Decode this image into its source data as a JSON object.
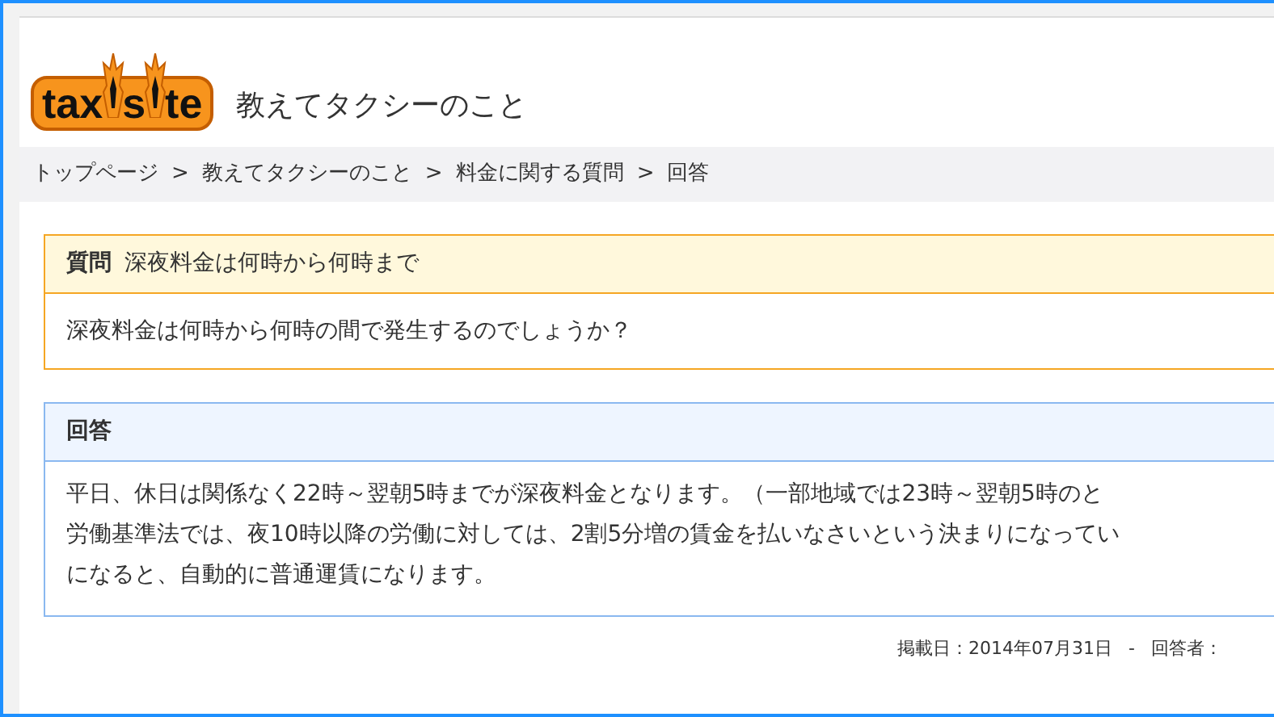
{
  "header": {
    "logo_parts": [
      "tax",
      "s",
      "te"
    ],
    "site_title": "教えてタクシーのこと"
  },
  "breadcrumb": {
    "items": [
      "トップページ",
      "教えてタクシーのこと",
      "料金に関する質問",
      "回答"
    ],
    "separator": ">"
  },
  "question": {
    "label": "質問",
    "title": "深夜料金は何時から何時まで",
    "body": "深夜料金は何時から何時の間で発生するのでしょうか？"
  },
  "answer": {
    "label": "回答",
    "lines": [
      "平日、休日は関係なく22時～翌朝5時までが深夜料金となります。（一部地域では23時～翌朝5時のと",
      "労働基準法では、夜10時以降の労働に対しては、2割5分増の賃金を払いなさいという決まりになってい",
      "になると、自動的に普通運賃になります。"
    ]
  },
  "footer": {
    "posted": "掲載日：2014年07月31日",
    "separator": "-",
    "answerer": "回答者："
  }
}
